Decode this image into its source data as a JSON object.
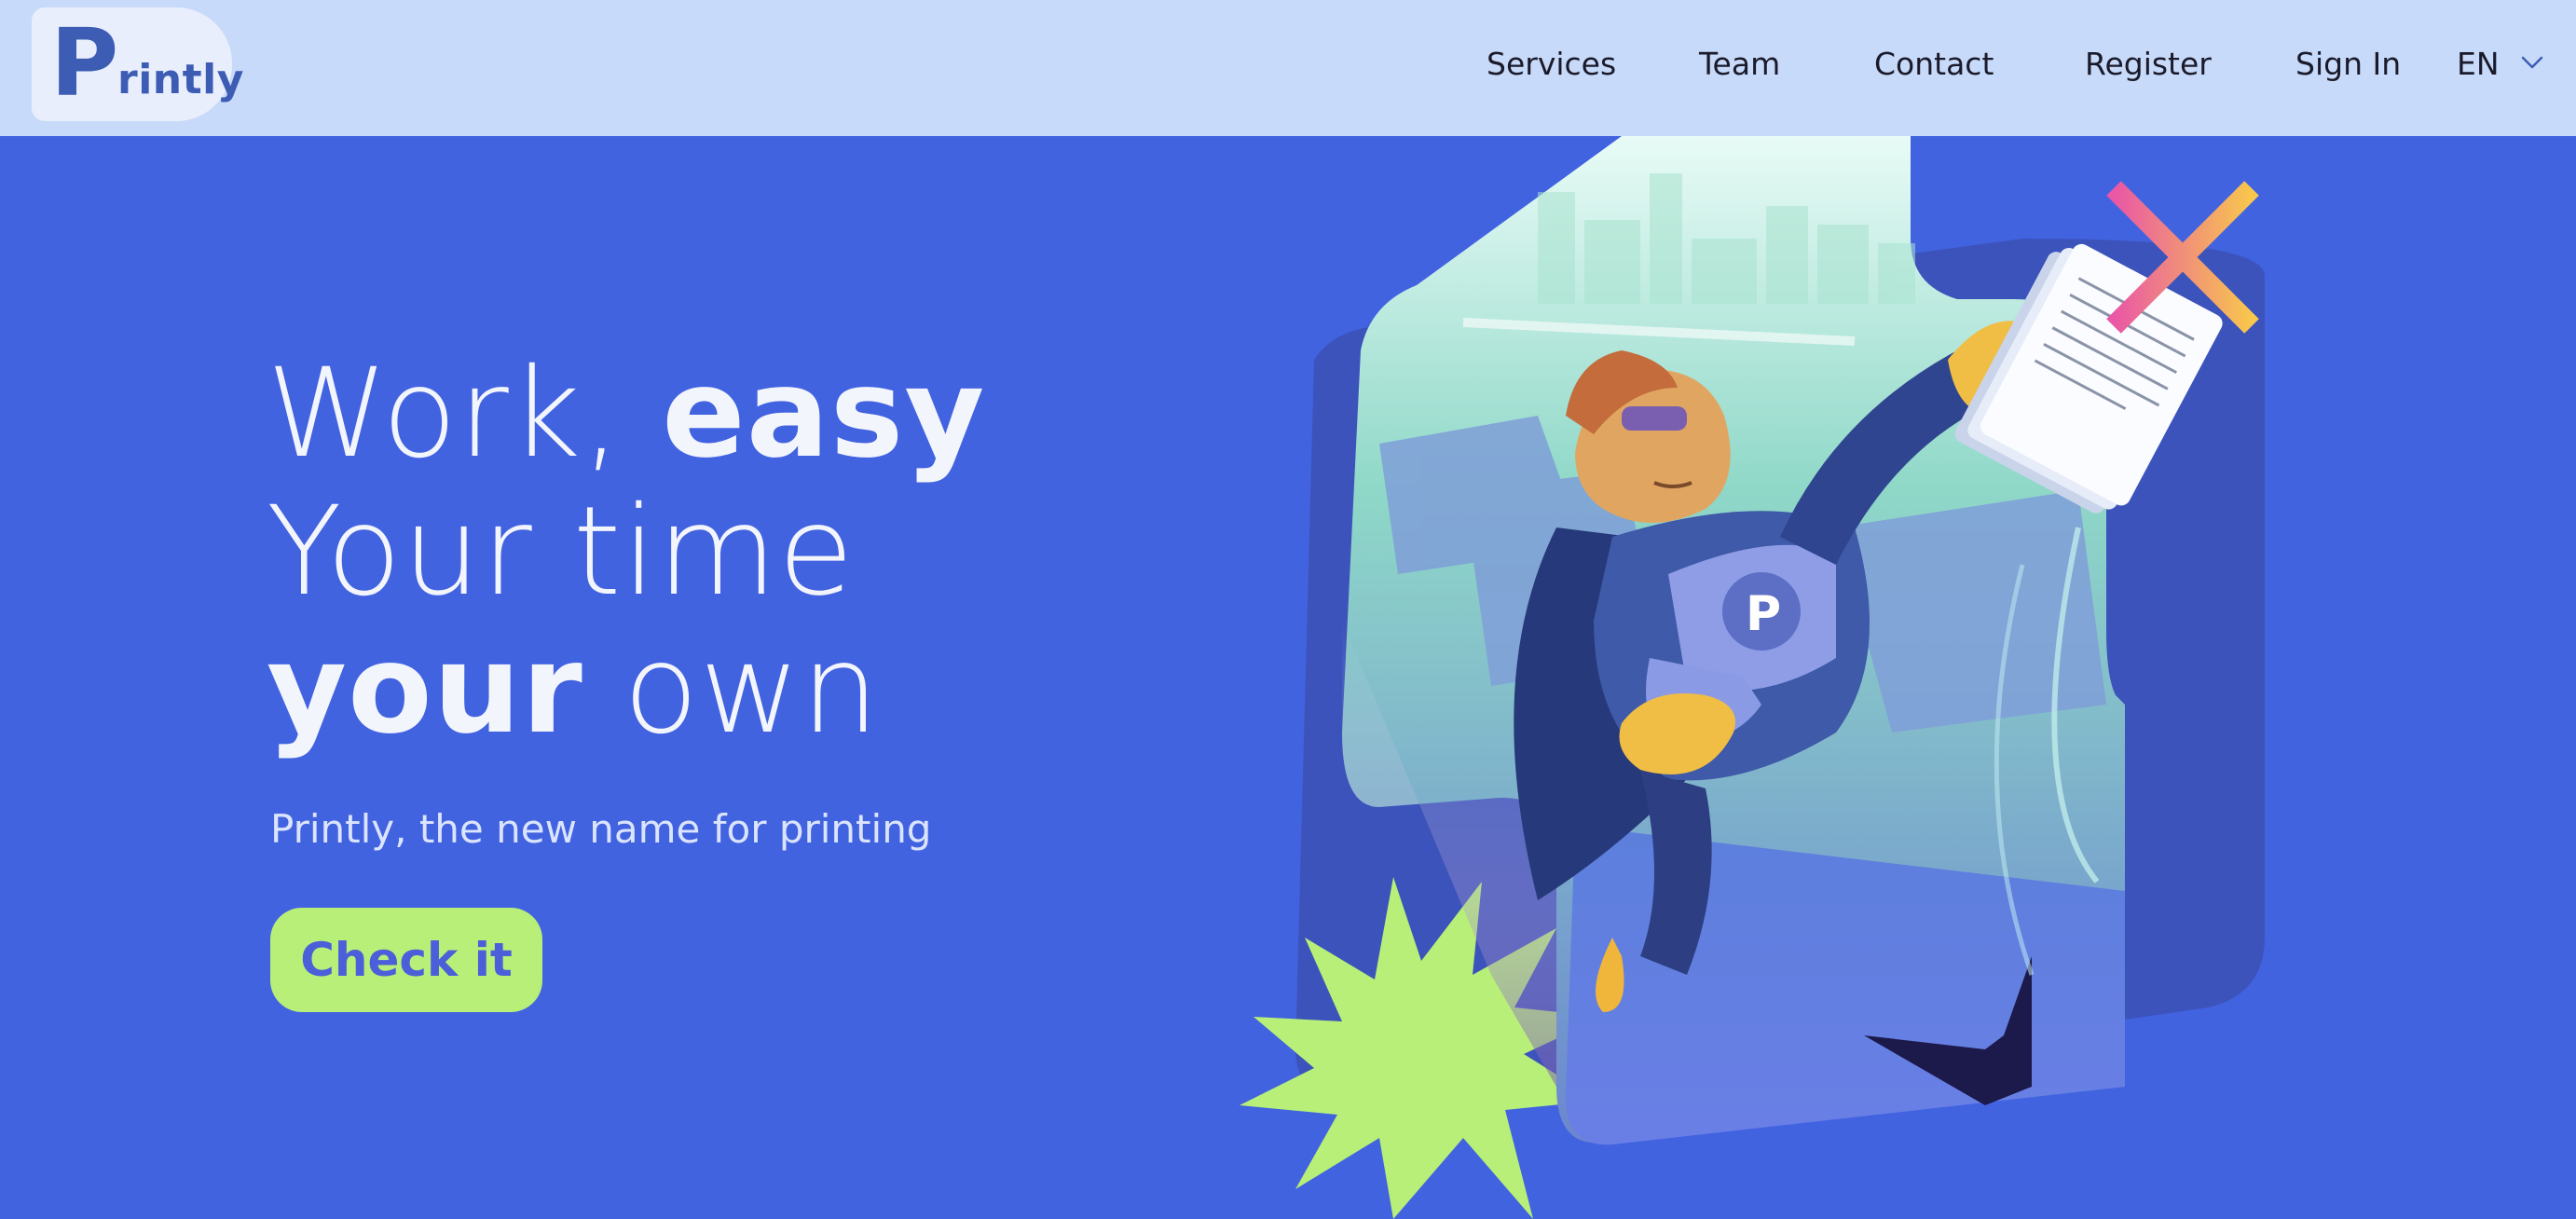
{
  "header": {
    "logo": {
      "letter": "P",
      "text": "rintly"
    },
    "nav": [
      {
        "label": "Services"
      },
      {
        "label": "Team"
      },
      {
        "label": "Contact"
      },
      {
        "label": "Register"
      },
      {
        "label": "Sign In"
      }
    ],
    "language": {
      "selected": "EN"
    }
  },
  "hero": {
    "headline": {
      "line1_thin": "Work, ",
      "line1_bold": "easy",
      "line2_thin": "Your time",
      "line3_bold": "your",
      "line3_thin": " own"
    },
    "subtitle": "Printly, the new name for printing",
    "cta_label": "Check it"
  },
  "illustration": {
    "badge_letter": "P"
  },
  "colors": {
    "background": "#4263e0",
    "header": "#c8daf9",
    "cta": "#b7ef78",
    "accent_star": "#b7ef78",
    "logo": "#3d5db5"
  }
}
